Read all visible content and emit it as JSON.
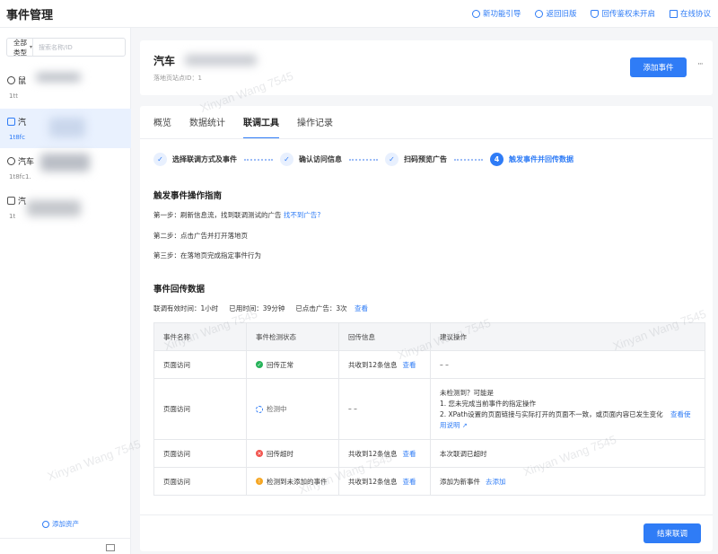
{
  "app": {
    "title": "事件管理"
  },
  "top_links": [
    {
      "label": "新功能引导",
      "icon": "compass-icon"
    },
    {
      "label": "返回旧版",
      "icon": "return-icon"
    },
    {
      "label": "回传鉴权未开启",
      "icon": "shield-icon"
    },
    {
      "label": "在线协议",
      "icon": "document-icon"
    }
  ],
  "sidebar": {
    "filter_type": "全部类型",
    "search_placeholder": "搜索名称/ID",
    "assets": [
      {
        "name": "鼠",
        "id": "1tt",
        "active": false
      },
      {
        "name": "汽",
        "id": "1t8fc",
        "active": true
      },
      {
        "name": "汽车",
        "id": "1t8fc1.",
        "active": false
      },
      {
        "name": "汽",
        "id": "1t",
        "active": false
      }
    ],
    "add_asset_label": "添加资产"
  },
  "header": {
    "title": "汽车",
    "subtitle": "落地页站点ID：1",
    "add_event_label": "添加事件",
    "more_label": "···"
  },
  "tabs": [
    {
      "label": "概览",
      "active": false
    },
    {
      "label": "数据统计",
      "active": false
    },
    {
      "label": "联调工具",
      "active": true
    },
    {
      "label": "操作记录",
      "active": false
    }
  ],
  "steps": [
    {
      "mark": "✓",
      "label": "选择联调方式及事件",
      "done": true
    },
    {
      "mark": "✓",
      "label": "确认访问信息",
      "done": true
    },
    {
      "mark": "✓",
      "label": "扫码预览广告",
      "done": true
    },
    {
      "mark": "4",
      "label": "触发事件并回传数据",
      "done": false
    }
  ],
  "guide": {
    "title": "触发事件操作指南",
    "step1": "第一步：刷新信息流，找到联调测试的广告",
    "step1_link": "找不到广告?",
    "step2": "第二步：点击广告并打开落地页",
    "step3": "第三步：在落地页完成指定事件行为"
  },
  "callback": {
    "title": "事件回传数据",
    "valid_time": "联调有效时间：1小时",
    "used_time": "已用时间：39分钟",
    "clicked": "已点击广告：3次",
    "view_link": "查看"
  },
  "table": {
    "headers": [
      "事件名称",
      "事件检测状态",
      "回传信息",
      "建议操作"
    ],
    "rows": [
      {
        "name": "页面访问",
        "status": "回传正常",
        "status_type": "ok",
        "info": "共收到12条信息",
        "info_link": "查看",
        "suggest": "– –"
      },
      {
        "name": "页面访问",
        "status": "检测中",
        "status_type": "loading",
        "info": "– –",
        "info_link": "",
        "suggest_lines": [
          "未检测到？可能是",
          "1. 您未完成当前事件的指定操作",
          "2. XPath设置的页面链接与实际打开的页面不一致，或页面内容已发生变化"
        ],
        "suggest_link": "查看使用说明"
      },
      {
        "name": "页面访问",
        "status": "回传超时",
        "status_type": "error",
        "info": "共收到12条信息",
        "info_link": "查看",
        "suggest": "本次联调已超时"
      },
      {
        "name": "页面访问",
        "status": "检测到未添加的事件",
        "status_type": "warn",
        "info": "共收到12条信息",
        "info_link": "查看",
        "suggest": "添加为新事件",
        "suggest_link": "去添加"
      }
    ]
  },
  "footer": {
    "end_label": "结束联调"
  },
  "watermark": "Xinyan Wang 7545"
}
